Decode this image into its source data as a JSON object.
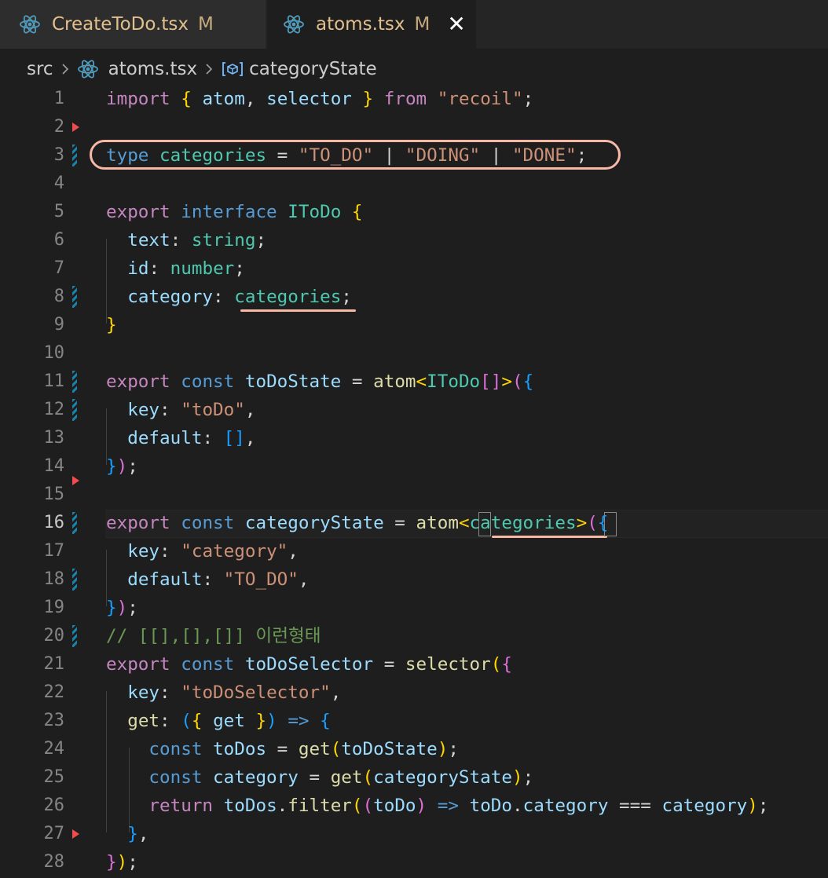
{
  "tabs": [
    {
      "label": "CreateToDo.tsx",
      "badge": "M",
      "icon": "react-icon",
      "active": false
    },
    {
      "label": "atoms.tsx",
      "badge": "M",
      "icon": "react-icon",
      "active": true,
      "close": "✕"
    }
  ],
  "breadcrumb": {
    "folder": "src",
    "file": "atoms.tsx",
    "symbol": "categoryState"
  },
  "editor": {
    "active_line": 16,
    "line_numbers": [
      "1",
      "2",
      "3",
      "4",
      "5",
      "6",
      "7",
      "8",
      "9",
      "10",
      "11",
      "12",
      "13",
      "14",
      "15",
      "16",
      "17",
      "18",
      "19",
      "20",
      "21",
      "22",
      "23",
      "24",
      "25",
      "26",
      "27",
      "28"
    ],
    "annotation": {
      "highlighted_line": 3,
      "underlined": [
        "categories",
        "categories"
      ]
    }
  },
  "colors": {
    "keyword": "#c586c0",
    "storage": "#569cd6",
    "type": "#4ec9b0",
    "variable": "#9cdcfe",
    "string": "#ce9178",
    "function": "#dcdcaa",
    "comment": "#6a9955",
    "annotation": "#f7b9a6",
    "tab_modified": "#e2c08d"
  },
  "code": {
    "l1": [
      [
        "k",
        "import"
      ],
      [
        "p",
        " "
      ],
      [
        "y",
        "{"
      ],
      [
        "p",
        " "
      ],
      [
        "v",
        "atom"
      ],
      [
        "p",
        ", "
      ],
      [
        "v",
        "selector"
      ],
      [
        "p",
        " "
      ],
      [
        "y",
        "}"
      ],
      [
        "p",
        " "
      ],
      [
        "k",
        "from"
      ],
      [
        "p",
        " "
      ],
      [
        "s",
        "\"recoil\""
      ],
      [
        "p",
        ";"
      ]
    ],
    "l2": [],
    "l3": [
      [
        "b",
        "type"
      ],
      [
        "p",
        " "
      ],
      [
        "t",
        "categories"
      ],
      [
        "p",
        " = "
      ],
      [
        "s",
        "\"TO_DO\""
      ],
      [
        "p",
        " | "
      ],
      [
        "s",
        "\"DOING\""
      ],
      [
        "p",
        " | "
      ],
      [
        "s",
        "\"DONE\""
      ],
      [
        "p",
        ";"
      ]
    ],
    "l4": [],
    "l5": [
      [
        "k",
        "export"
      ],
      [
        "p",
        " "
      ],
      [
        "b",
        "interface"
      ],
      [
        "p",
        " "
      ],
      [
        "t",
        "IToDo"
      ],
      [
        "p",
        " "
      ],
      [
        "y",
        "{"
      ]
    ],
    "l6": [
      [
        "p",
        "  "
      ],
      [
        "v",
        "text"
      ],
      [
        "p",
        ": "
      ],
      [
        "t",
        "string"
      ],
      [
        "p",
        ";"
      ]
    ],
    "l7": [
      [
        "p",
        "  "
      ],
      [
        "v",
        "id"
      ],
      [
        "p",
        ": "
      ],
      [
        "t",
        "number"
      ],
      [
        "p",
        ";"
      ]
    ],
    "l8": [
      [
        "p",
        "  "
      ],
      [
        "v",
        "category"
      ],
      [
        "p",
        ": "
      ],
      [
        "t",
        "categories"
      ],
      [
        "p",
        ";"
      ]
    ],
    "l9": [
      [
        "y",
        "}"
      ]
    ],
    "l10": [],
    "l11": [
      [
        "k",
        "export"
      ],
      [
        "p",
        " "
      ],
      [
        "b",
        "const"
      ],
      [
        "p",
        " "
      ],
      [
        "v",
        "toDoState"
      ],
      [
        "p",
        " = "
      ],
      [
        "f",
        "atom"
      ],
      [
        "y",
        "<"
      ],
      [
        "t",
        "IToDo"
      ],
      [
        "m",
        "[]"
      ],
      [
        "y",
        ">"
      ],
      [
        "m",
        "("
      ],
      [
        "bl",
        "{"
      ]
    ],
    "l12": [
      [
        "p",
        "  "
      ],
      [
        "v",
        "key"
      ],
      [
        "p",
        ": "
      ],
      [
        "s",
        "\"toDo\""
      ],
      [
        "p",
        ","
      ]
    ],
    "l13": [
      [
        "p",
        "  "
      ],
      [
        "v",
        "default"
      ],
      [
        "p",
        ": "
      ],
      [
        "bl",
        "[]"
      ],
      [
        "p",
        ","
      ]
    ],
    "l14": [
      [
        "bl",
        "}"
      ],
      [
        "m",
        ")"
      ],
      [
        "p",
        ";"
      ]
    ],
    "l15": [],
    "l16": [
      [
        "k",
        "export"
      ],
      [
        "p",
        " "
      ],
      [
        "b",
        "const"
      ],
      [
        "p",
        " "
      ],
      [
        "v",
        "categoryState"
      ],
      [
        "p",
        " = "
      ],
      [
        "f",
        "atom"
      ],
      [
        "y",
        "<"
      ],
      [
        "t",
        "categories"
      ],
      [
        "y",
        ">"
      ],
      [
        "m",
        "("
      ],
      [
        "bl",
        "{"
      ]
    ],
    "l17": [
      [
        "p",
        "  "
      ],
      [
        "v",
        "key"
      ],
      [
        "p",
        ": "
      ],
      [
        "s",
        "\"category\""
      ],
      [
        "p",
        ","
      ]
    ],
    "l18": [
      [
        "p",
        "  "
      ],
      [
        "v",
        "default"
      ],
      [
        "p",
        ": "
      ],
      [
        "s",
        "\"TO_DO\""
      ],
      [
        "p",
        ","
      ]
    ],
    "l19": [
      [
        "bl",
        "}"
      ],
      [
        "m",
        ")"
      ],
      [
        "p",
        ";"
      ]
    ],
    "l20": [
      [
        "c",
        "// [[],[],[]] 이런형태"
      ]
    ],
    "l21": [
      [
        "k",
        "export"
      ],
      [
        "p",
        " "
      ],
      [
        "b",
        "const"
      ],
      [
        "p",
        " "
      ],
      [
        "v",
        "toDoSelector"
      ],
      [
        "p",
        " = "
      ],
      [
        "f",
        "selector"
      ],
      [
        "y",
        "("
      ],
      [
        "m",
        "{"
      ]
    ],
    "l22": [
      [
        "p",
        "  "
      ],
      [
        "v",
        "key"
      ],
      [
        "p",
        ": "
      ],
      [
        "s",
        "\"toDoSelector\""
      ],
      [
        "p",
        ","
      ]
    ],
    "l23": [
      [
        "p",
        "  "
      ],
      [
        "f",
        "get"
      ],
      [
        "p",
        ": "
      ],
      [
        "bl",
        "("
      ],
      [
        "y",
        "{"
      ],
      [
        "p",
        " "
      ],
      [
        "v",
        "get"
      ],
      [
        "p",
        " "
      ],
      [
        "y",
        "}"
      ],
      [
        "bl",
        ")"
      ],
      [
        "p",
        " "
      ],
      [
        "b",
        "=>"
      ],
      [
        "p",
        " "
      ],
      [
        "bl",
        "{"
      ]
    ],
    "l24": [
      [
        "p",
        "    "
      ],
      [
        "b",
        "const"
      ],
      [
        "p",
        " "
      ],
      [
        "v",
        "toDos"
      ],
      [
        "p",
        " = "
      ],
      [
        "f",
        "get"
      ],
      [
        "y",
        "("
      ],
      [
        "v",
        "toDoState"
      ],
      [
        "y",
        ")"
      ],
      [
        "p",
        ";"
      ]
    ],
    "l25": [
      [
        "p",
        "    "
      ],
      [
        "b",
        "const"
      ],
      [
        "p",
        " "
      ],
      [
        "v",
        "category"
      ],
      [
        "p",
        " = "
      ],
      [
        "f",
        "get"
      ],
      [
        "y",
        "("
      ],
      [
        "v",
        "categoryState"
      ],
      [
        "y",
        ")"
      ],
      [
        "p",
        ";"
      ]
    ],
    "l26": [
      [
        "p",
        "    "
      ],
      [
        "k",
        "return"
      ],
      [
        "p",
        " "
      ],
      [
        "v",
        "toDos"
      ],
      [
        "p",
        "."
      ],
      [
        "f",
        "filter"
      ],
      [
        "y",
        "("
      ],
      [
        "m",
        "("
      ],
      [
        "v",
        "toDo"
      ],
      [
        "m",
        ")"
      ],
      [
        "p",
        " "
      ],
      [
        "b",
        "=>"
      ],
      [
        "p",
        " "
      ],
      [
        "v",
        "toDo"
      ],
      [
        "p",
        "."
      ],
      [
        "v",
        "category"
      ],
      [
        "p",
        " === "
      ],
      [
        "v",
        "category"
      ],
      [
        "y",
        ")"
      ],
      [
        "p",
        ";"
      ]
    ],
    "l27": [
      [
        "p",
        "  "
      ],
      [
        "bl",
        "}"
      ],
      [
        "p",
        ","
      ]
    ],
    "l28": [
      [
        "m",
        "}"
      ],
      [
        "y",
        ")"
      ],
      [
        "p",
        ";"
      ]
    ]
  }
}
